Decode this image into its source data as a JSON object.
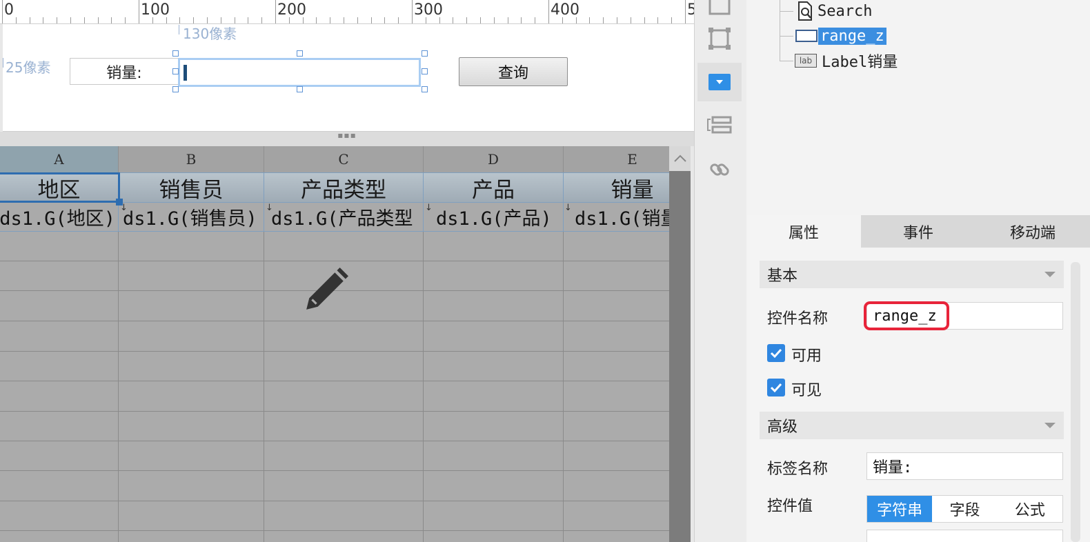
{
  "ruler": {
    "labels": [
      "0",
      "100",
      "200",
      "300",
      "400",
      "5"
    ]
  },
  "form": {
    "dim_left": "130像素",
    "dim_top": "25像素",
    "label_text": "销量:",
    "query_button": "查询"
  },
  "sheet": {
    "columns": [
      "A",
      "B",
      "C",
      "D",
      "E"
    ],
    "titles": [
      "地区",
      "销售员",
      "产品类型",
      "产品",
      "销量"
    ],
    "data": [
      "ds1.G(地区)",
      "ds1.G(销售员)",
      "ds1.G(产品类型",
      "ds1.G(产品)",
      "ds1.G(销量"
    ],
    "selected_column": "A"
  },
  "tree": {
    "items": [
      {
        "icon": "search-widget-icon",
        "label": "Search",
        "selected": false
      },
      {
        "icon": "textbox-widget-icon",
        "label": "range_z",
        "selected": true
      },
      {
        "icon": "label-widget-icon",
        "label": "Label销量",
        "selected": false
      }
    ],
    "label_icon_text": "lab"
  },
  "tabs": {
    "items": [
      "属性",
      "事件",
      "移动端"
    ],
    "active": "属性"
  },
  "props": {
    "basic_header": "基本",
    "name_label": "控件名称",
    "name_value": "range_z",
    "enabled_label": "可用",
    "enabled": true,
    "visible_label": "可见",
    "visible": true,
    "advanced_header": "高级",
    "tag_label": "标签名称",
    "tag_value": "销量:",
    "value_label": "控件值",
    "value_types": [
      "字符串",
      "字段",
      "公式"
    ],
    "value_type_active": "字符串"
  },
  "colors": {
    "accent": "#2f8fe6",
    "highlight": "#e8243a",
    "selection": "#2e6db0"
  }
}
